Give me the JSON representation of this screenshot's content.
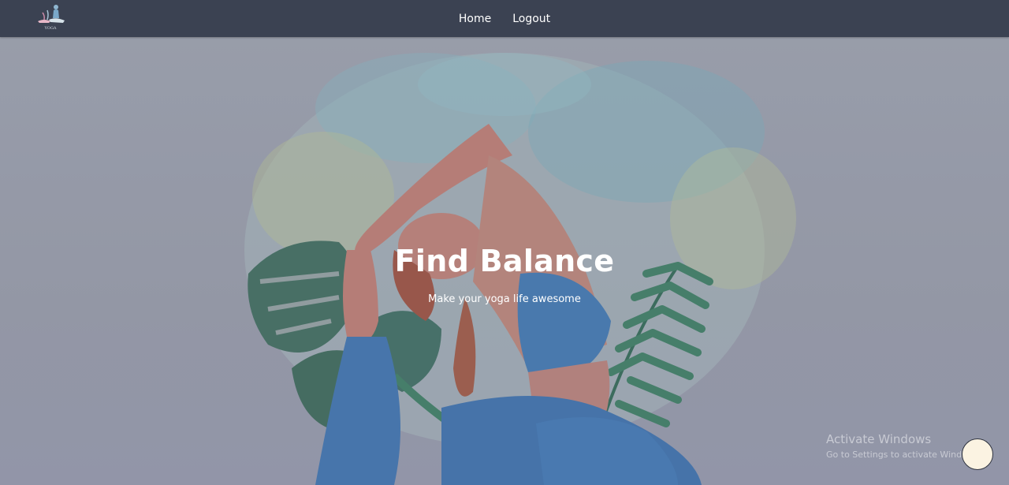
{
  "nav": {
    "logo_text": "YOGA",
    "links": [
      "Home",
      "Logout"
    ]
  },
  "hero": {
    "title": "Find Balance",
    "subtitle": "Make your yoga life awesome"
  },
  "watermark": {
    "title": "Activate Windows",
    "subtitle": "Go to Settings to activate Windows."
  },
  "colors": {
    "navbar": "#3b4252",
    "hero_bg": "#9ea2ae",
    "text": "#ffffff",
    "fab": "#fbf3e2"
  },
  "icons": [
    "yoga-logo-icon",
    "floating-action-button"
  ]
}
